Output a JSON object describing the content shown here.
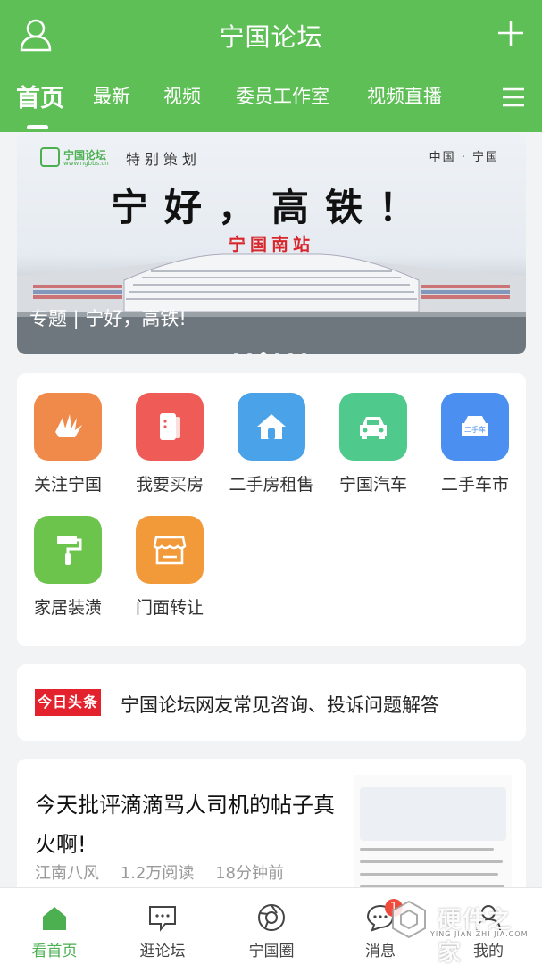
{
  "header": {
    "title": "宁国论坛",
    "tabs": [
      "首页",
      "最新",
      "视频",
      "委员工作室",
      "视频直播"
    ],
    "active_tab": 0,
    "accent_color": "#5fbf57"
  },
  "banner": {
    "logo_text": "宁国论坛",
    "logo_sub": "www.ngbbs.cn",
    "special": "特别策划",
    "region": "中国 · 宁国",
    "headline": "宁好，高铁！",
    "station": "宁国南站",
    "caption": "专题 | 宁好，高铁!",
    "slide_count": 6,
    "active_slide": 2
  },
  "services": [
    {
      "label": "关注宁国",
      "icon": "hand-icon",
      "color": "#f08a4b"
    },
    {
      "label": "我要买房",
      "icon": "phone-icon",
      "color": "#ef5b57"
    },
    {
      "label": "二手房租售",
      "icon": "house-icon",
      "color": "#4aa3e8"
    },
    {
      "label": "宁国汽车",
      "icon": "car-icon",
      "color": "#4fc98c"
    },
    {
      "label": "二手车市",
      "icon": "used-car-icon",
      "color": "#4b8ff0",
      "icon_text": "二手车"
    },
    {
      "label": "家居装潢",
      "icon": "paint-roller-icon",
      "color": "#6cc44c"
    },
    {
      "label": "门面转让",
      "icon": "storefront-icon",
      "color": "#f29a3a"
    }
  ],
  "news": {
    "logo": "今日头条",
    "text": "宁国论坛网友常见咨询、投诉问题解答"
  },
  "post": {
    "title": "今天批评滴滴骂人司机的帖子真火啊!",
    "author": "江南八风",
    "reads": "1.2万阅读",
    "time": "18分钟前"
  },
  "bottom_nav": [
    {
      "label": "看首页",
      "icon": "home-icon"
    },
    {
      "label": "逛论坛",
      "icon": "forum-icon"
    },
    {
      "label": "宁国圈",
      "icon": "circle-icon"
    },
    {
      "label": "消息",
      "icon": "message-icon",
      "badge": "1"
    },
    {
      "label": "我的",
      "icon": "profile-icon"
    }
  ],
  "watermark": {
    "text": "硬件之家",
    "sub": "YING JIAN ZHI JIA.COM"
  }
}
